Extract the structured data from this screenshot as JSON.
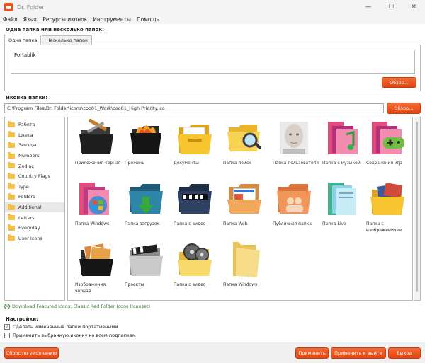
{
  "window": {
    "title": "Dr. Folder",
    "minimize": "—",
    "maximize": "☐",
    "close": "✕"
  },
  "menu": [
    "Файл",
    "Язык",
    "Ресурсы иконок",
    "Инструменты",
    "Помощь"
  ],
  "folders_section": {
    "label": "Одна папка или несколько папок:",
    "tabs": [
      "Одна папка",
      "Несколько папок"
    ],
    "folder_value": "Portablik",
    "browse_label": "Обзор..."
  },
  "icon_section": {
    "label": "Иконка папки:",
    "path_value": "C:\\Program Files\\Dr. Folder\\icons\\coo01_Work\\coo01_High Priority.ico",
    "browse_label": "Обзор..."
  },
  "categories": [
    "Работа",
    "Цвета",
    "Звезды",
    "Numbers",
    "Zodiac",
    "Country Flags",
    "Type",
    "Folders",
    "Additional",
    "Letters",
    "Everyday",
    "User Icons"
  ],
  "selected_category": "Additional",
  "icons": [
    {
      "label": "Приложения черная",
      "icon": "tools-folder-icon"
    },
    {
      "label": "Прожечь",
      "icon": "burn-folder-icon"
    },
    {
      "label": "Документы",
      "icon": "documents-folder-icon"
    },
    {
      "label": "Папка поиск",
      "icon": "search-folder-icon"
    },
    {
      "label": "Папка пользователя",
      "icon": "user-folder-icon"
    },
    {
      "label": "Папка с музыкой",
      "icon": "music-folder-icon"
    },
    {
      "label": "Сохранения игр",
      "icon": "games-folder-icon"
    },
    {
      "label": "Папка Windows",
      "icon": "windows-folder-icon"
    },
    {
      "label": "Папка загрузок",
      "icon": "downloads-folder-icon"
    },
    {
      "label": "Папка с видео",
      "icon": "video-folder-icon"
    },
    {
      "label": "Папка Web",
      "icon": "web-folder-icon"
    },
    {
      "label": "Публичная папка",
      "icon": "public-folder-icon"
    },
    {
      "label": "Папка Live",
      "icon": "live-folder-icon"
    },
    {
      "label": "Папка с изображениями",
      "icon": "pictures-folder-icon"
    },
    {
      "label": "Изображения черная",
      "icon": "images-black-folder-icon"
    },
    {
      "label": "Проекты",
      "icon": "projects-folder-icon"
    },
    {
      "label": "Папка с видео",
      "icon": "film-reel-folder-icon"
    },
    {
      "label": "Папка Windows",
      "icon": "plain-folder-icon"
    }
  ],
  "download_link": "Download Featured Icons: Classic Red Folder Icons (Iconset)",
  "settings": {
    "label": "Настройки:",
    "options": [
      {
        "label": "Сделать измененные папки портативными",
        "checked": true
      },
      {
        "label": "Применить выбранную иконку ко всем подпапкам",
        "checked": false
      }
    ]
  },
  "buttons": {
    "reset": "Сброс по умолчанию",
    "apply": "Применить",
    "apply_exit": "Применить и выйти",
    "exit": "Выход"
  },
  "colors": {
    "accent": "#e5531a",
    "link": "#2e7d32"
  }
}
